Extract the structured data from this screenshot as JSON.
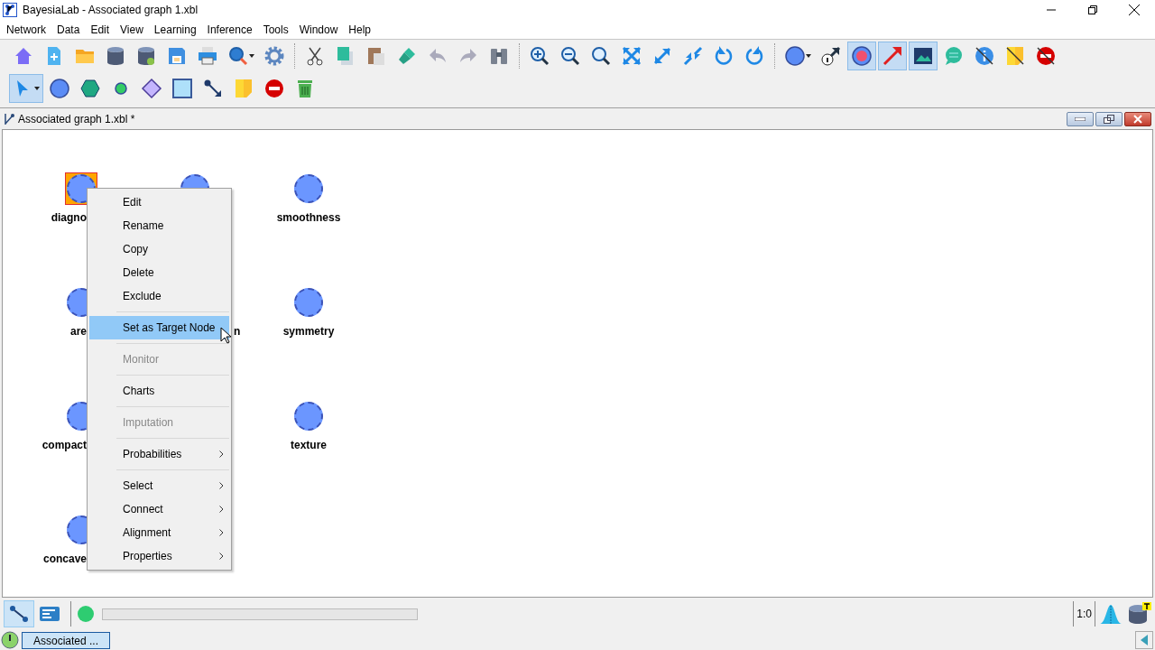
{
  "window": {
    "title": "BayesiaLab - Associated graph 1.xbl"
  },
  "menu_bar": [
    "Network",
    "Data",
    "Edit",
    "View",
    "Learning",
    "Inference",
    "Tools",
    "Window",
    "Help"
  ],
  "toolbar_1": [
    {
      "kind": "home",
      "selected": false
    },
    {
      "kind": "new",
      "selected": false
    },
    {
      "kind": "open",
      "selected": false
    },
    {
      "kind": "database",
      "selected": false
    },
    {
      "kind": "database-link",
      "selected": false
    },
    {
      "kind": "save",
      "selected": false
    },
    {
      "kind": "print",
      "selected": false
    },
    {
      "kind": "inspect",
      "selected": false
    },
    {
      "kind": "settings",
      "selected": false
    },
    {
      "kind": "separator"
    },
    {
      "kind": "cut",
      "selected": false
    },
    {
      "kind": "copy",
      "selected": false
    },
    {
      "kind": "paste",
      "selected": false
    },
    {
      "kind": "brush",
      "selected": false
    },
    {
      "kind": "undo",
      "selected": false
    },
    {
      "kind": "redo",
      "selected": false
    },
    {
      "kind": "binoculars",
      "selected": false
    },
    {
      "kind": "separator"
    },
    {
      "kind": "zoom-in",
      "selected": false
    },
    {
      "kind": "zoom-out",
      "selected": false
    },
    {
      "kind": "zoom-fit",
      "selected": false
    },
    {
      "kind": "expand-all",
      "selected": false
    },
    {
      "kind": "expand",
      "selected": false
    },
    {
      "kind": "shrink",
      "selected": false
    },
    {
      "kind": "rotate-left",
      "selected": false
    },
    {
      "kind": "rotate-right",
      "selected": false
    },
    {
      "kind": "separator"
    },
    {
      "kind": "node-style",
      "selected": false
    },
    {
      "kind": "arc-info",
      "selected": false
    },
    {
      "kind": "target",
      "selected": true
    },
    {
      "kind": "arrow",
      "selected": true
    },
    {
      "kind": "image",
      "selected": true
    },
    {
      "kind": "comment",
      "selected": false
    },
    {
      "kind": "info-off",
      "selected": false
    },
    {
      "kind": "note-off",
      "selected": false
    },
    {
      "kind": "stop-off",
      "selected": false
    }
  ],
  "toolbar_2": [
    {
      "kind": "pointer",
      "selected": true
    },
    {
      "kind": "circle",
      "selected": false
    },
    {
      "kind": "hexagon",
      "selected": false
    },
    {
      "kind": "small-circle",
      "selected": false
    },
    {
      "kind": "diamond",
      "selected": false
    },
    {
      "kind": "square",
      "selected": false
    },
    {
      "kind": "link",
      "selected": false
    },
    {
      "kind": "note",
      "selected": false
    },
    {
      "kind": "forbidden",
      "selected": false
    },
    {
      "kind": "trash",
      "selected": false
    }
  ],
  "document": {
    "title": "Associated graph 1.xbl *"
  },
  "graph": {
    "rows": [
      [
        {
          "label": "diagno",
          "selected": true
        },
        {
          "selected": false
        },
        {
          "label": "smoothness",
          "selected": false
        }
      ],
      [
        {
          "label": "are",
          "selected": false
        },
        {
          "label": "n"
        },
        {
          "label": "symmetry",
          "selected": false
        }
      ],
      [
        {
          "label": "compact",
          "selected": false
        },
        null,
        {
          "label": "texture",
          "selected": false
        }
      ],
      [
        {
          "label": "concave",
          "selected": false
        },
        null,
        null
      ]
    ]
  },
  "context_menu": [
    [
      {
        "label": "Edit",
        "disabled": false,
        "selected": false,
        "submenu": false
      },
      {
        "label": "Rename",
        "disabled": false,
        "selected": false,
        "submenu": false
      },
      {
        "label": "Copy",
        "disabled": false,
        "selected": false,
        "submenu": false
      },
      {
        "label": "Delete",
        "disabled": false,
        "selected": false,
        "submenu": false
      },
      {
        "label": "Exclude",
        "disabled": false,
        "selected": false,
        "submenu": false
      }
    ],
    [
      {
        "label": "Set as Target Node",
        "disabled": false,
        "selected": true,
        "submenu": false
      }
    ],
    [
      {
        "label": "Monitor",
        "disabled": true,
        "selected": false,
        "submenu": false
      }
    ],
    [
      {
        "label": "Charts",
        "disabled": false,
        "selected": false,
        "submenu": false
      }
    ],
    [
      {
        "label": "Imputation",
        "disabled": true,
        "selected": false,
        "submenu": false
      }
    ],
    [
      {
        "label": "Probabilities",
        "disabled": false,
        "selected": false,
        "submenu": true
      }
    ],
    [
      {
        "label": "Select",
        "disabled": false,
        "selected": false,
        "submenu": true
      },
      {
        "label": "Connect",
        "disabled": false,
        "selected": false,
        "submenu": true
      },
      {
        "label": "Alignment",
        "disabled": false,
        "selected": false,
        "submenu": true
      },
      {
        "label": "Properties",
        "disabled": false,
        "selected": false,
        "submenu": true
      }
    ]
  ],
  "bottom_bar": {
    "modes": [
      {
        "kind": "graph",
        "selected": true
      },
      {
        "kind": "console",
        "selected": false
      }
    ],
    "ratio": "1:0"
  },
  "taskbar": {
    "items": [
      {
        "label": "Associated ...",
        "selected": true
      }
    ]
  }
}
